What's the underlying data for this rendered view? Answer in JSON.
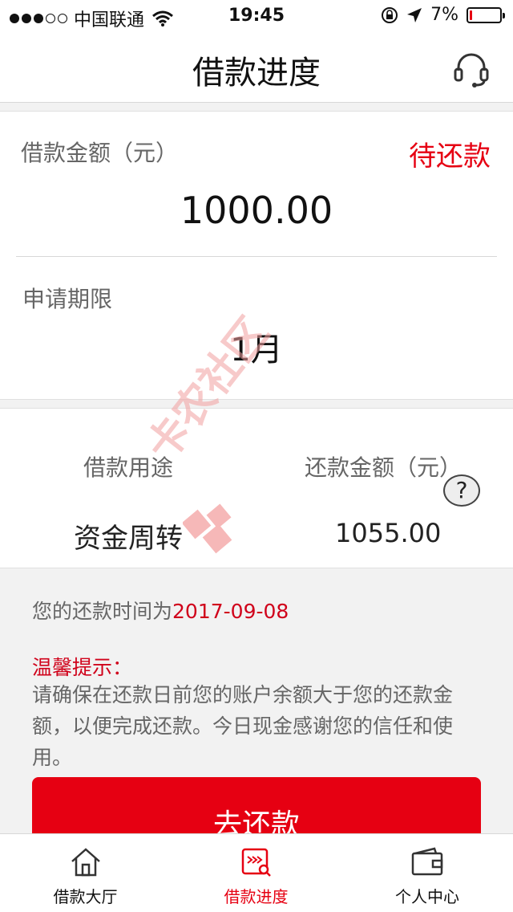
{
  "status_bar": {
    "carrier": "中国联通",
    "time": "19:45",
    "battery_percent": "7%",
    "battery_level": 0.07,
    "signal_dots_filled": 3,
    "signal_dots_total": 5
  },
  "nav": {
    "title": "借款进度",
    "service_icon": "headset-icon"
  },
  "loan": {
    "amount_label": "借款金额（元）",
    "status": "待还款",
    "amount": "1000.00",
    "term_label": "申请期限",
    "term": "1月"
  },
  "details": {
    "purpose_label": "借款用途",
    "purpose": "资金周转",
    "repay_amount_label": "还款金额（元）",
    "repay_amount": "1055.00",
    "help_icon_text": "?"
  },
  "info": {
    "repay_date_prefix": "您的还款时间为",
    "repay_date": "2017-09-08",
    "tip_title": "温馨提示：",
    "tip_body": "请确保在还款日前您的账户余额大于您的还款金额，以便完成还款。今日现金感谢您的信任和使用。"
  },
  "pay_button": "去还款",
  "tabs": [
    {
      "label": "借款大厅",
      "icon": "home-icon",
      "active": false
    },
    {
      "label": "借款进度",
      "icon": "progress-icon",
      "active": true
    },
    {
      "label": "个人中心",
      "icon": "wallet-icon",
      "active": false
    }
  ],
  "watermark": "卡农社区",
  "colors": {
    "accent": "#e60012",
    "text_muted": "#666666",
    "background": "#f2f2f2"
  }
}
